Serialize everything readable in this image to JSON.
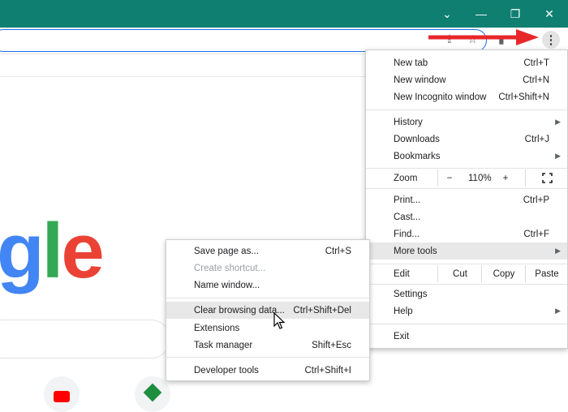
{
  "window": {
    "chevron_icon": "chevron-down-icon",
    "minimize_icon": "minimize-icon",
    "restore_icon": "restore-icon",
    "close_icon": "close-icon",
    "minimize_glyph": "—",
    "restore_glyph": "❐",
    "close_glyph": "✕",
    "chevron_glyph": "⌄"
  },
  "page": {
    "logo_letters": [
      {
        "ch": "g",
        "color": "#4285f4"
      },
      {
        "ch": "l",
        "color": "#34a853"
      },
      {
        "ch": "e",
        "color": "#ea4335"
      }
    ]
  },
  "main_menu": {
    "new_tab": {
      "label": "New tab",
      "shortcut": "Ctrl+T"
    },
    "new_window": {
      "label": "New window",
      "shortcut": "Ctrl+N"
    },
    "new_incognito": {
      "label": "New Incognito window",
      "shortcut": "Ctrl+Shift+N"
    },
    "history": {
      "label": "History"
    },
    "downloads": {
      "label": "Downloads",
      "shortcut": "Ctrl+J"
    },
    "bookmarks": {
      "label": "Bookmarks"
    },
    "zoom": {
      "label": "Zoom",
      "minus": "−",
      "value": "110%",
      "plus": "+"
    },
    "print": {
      "label": "Print...",
      "shortcut": "Ctrl+P"
    },
    "cast": {
      "label": "Cast..."
    },
    "find": {
      "label": "Find...",
      "shortcut": "Ctrl+F"
    },
    "more_tools": {
      "label": "More tools"
    },
    "edit": {
      "label": "Edit",
      "cut": "Cut",
      "copy": "Copy",
      "paste": "Paste"
    },
    "settings": {
      "label": "Settings"
    },
    "help": {
      "label": "Help"
    },
    "exit": {
      "label": "Exit"
    }
  },
  "submenu": {
    "save_page": {
      "label": "Save page as...",
      "shortcut": "Ctrl+S"
    },
    "create_shortcut": {
      "label": "Create shortcut..."
    },
    "name_window": {
      "label": "Name window..."
    },
    "clear_browsing": {
      "label": "Clear browsing data...",
      "shortcut": "Ctrl+Shift+Del"
    },
    "extensions": {
      "label": "Extensions"
    },
    "task_manager": {
      "label": "Task manager",
      "shortcut": "Shift+Esc"
    },
    "developer_tools": {
      "label": "Developer tools",
      "shortcut": "Ctrl+Shift+I"
    }
  },
  "colors": {
    "titlebar": "#0f7f72",
    "annotation_arrow": "#e8272b",
    "highlight": "#e8e8e8"
  }
}
